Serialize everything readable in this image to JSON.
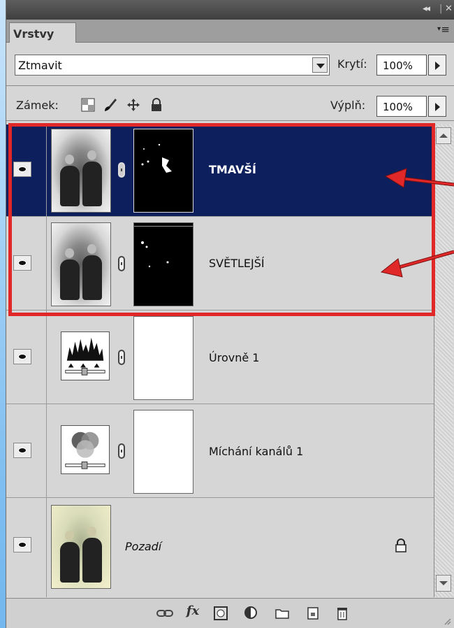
{
  "panel": {
    "tab_label": "Vrstvy",
    "blend_mode": "Ztmavit",
    "opacity_label": "Krytí:",
    "opacity_value": "100%",
    "lock_label": "Zámek:",
    "fill_label": "Výplň:",
    "fill_value": "100%",
    "titlebar_buttons": [
      "44",
      "X"
    ]
  },
  "layers": [
    {
      "name": "TMAVŠÍ",
      "selected": true,
      "kind": "photo-with-mask",
      "mask": "black"
    },
    {
      "name": "SVĚTLEJŠÍ",
      "selected": false,
      "kind": "photo-with-mask",
      "mask": "black"
    },
    {
      "name": "Úrovně 1",
      "selected": false,
      "kind": "adjustment-levels",
      "mask": "white"
    },
    {
      "name": "Míchání kanálů 1",
      "selected": false,
      "kind": "adjustment-channel-mixer",
      "mask": "white"
    },
    {
      "name": "Pozadí",
      "selected": false,
      "kind": "background",
      "locked": true
    }
  ],
  "bottom_icons": [
    "link-layers-icon",
    "fx-icon",
    "add-mask-icon",
    "adjustment-layer-icon",
    "new-group-icon",
    "new-layer-icon",
    "delete-layer-icon"
  ],
  "fx_label": "fx",
  "colors": {
    "selection": "#0e1f5d",
    "highlight_box": "#e02828"
  }
}
